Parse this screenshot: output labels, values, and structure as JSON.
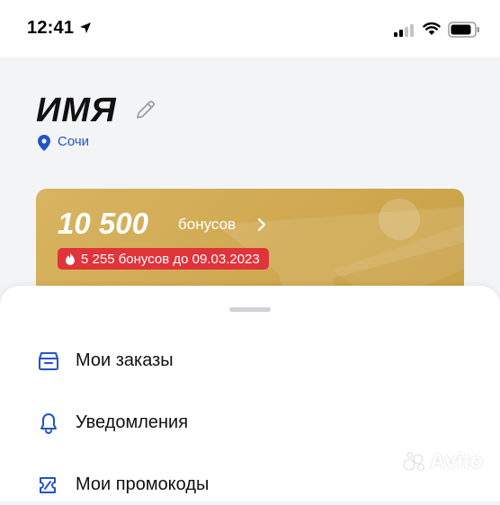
{
  "status_bar": {
    "time": "12:41"
  },
  "profile": {
    "name": "ИМЯ",
    "city": "Сочи"
  },
  "bonus_card": {
    "amount": "10 500",
    "amount_label": "бонусов",
    "expiring": "5 255 бонусов до 09.03.2023"
  },
  "menu": {
    "items": [
      {
        "label": "Мои заказы",
        "icon": "box-icon"
      },
      {
        "label": "Уведомления",
        "icon": "bell-icon"
      },
      {
        "label": "Мои промокоды",
        "icon": "tag-icon"
      }
    ]
  },
  "watermark": {
    "text": "Avito"
  },
  "colors": {
    "accent": "#2453c9",
    "card_gold": "#d4ad57",
    "badge_red": "#e0333a"
  }
}
